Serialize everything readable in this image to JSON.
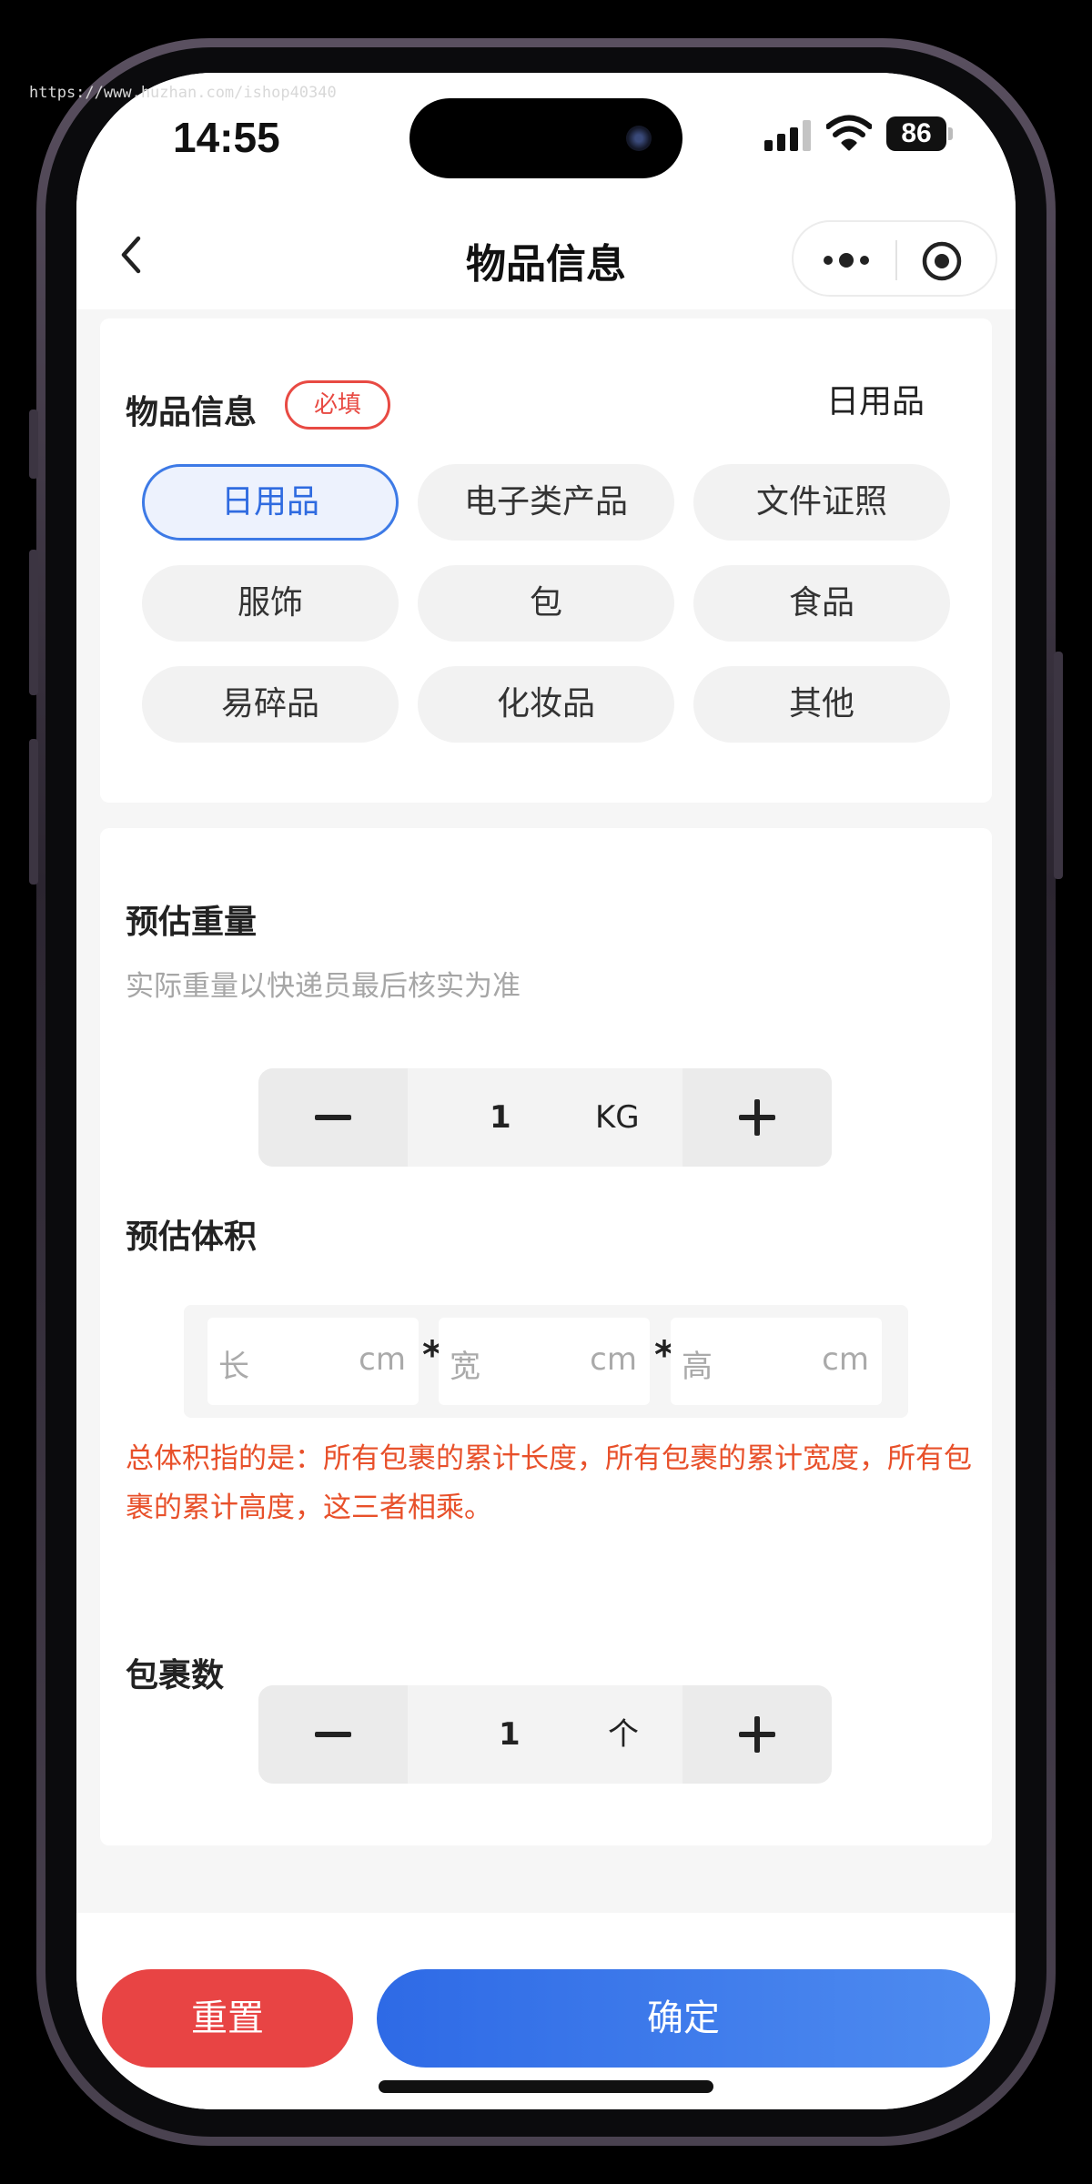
{
  "watermark": "https://www.huzhan.com/ishop40340",
  "status": {
    "time": "14:55",
    "battery": "86"
  },
  "nav": {
    "title": "物品信息"
  },
  "item_section": {
    "title": "物品信息",
    "required_badge": "必填",
    "selected": "日用品",
    "categories": [
      {
        "label": "日用品",
        "selected": true
      },
      {
        "label": "电子类产品",
        "selected": false
      },
      {
        "label": "文件证照",
        "selected": false
      },
      {
        "label": "服饰",
        "selected": false
      },
      {
        "label": "包",
        "selected": false
      },
      {
        "label": "食品",
        "selected": false
      },
      {
        "label": "易碎品",
        "selected": false
      },
      {
        "label": "化妆品",
        "selected": false
      },
      {
        "label": "其他",
        "selected": false
      }
    ]
  },
  "weight": {
    "title": "预估重量",
    "hint": "实际重量以快递员最后核实为准",
    "value": "1",
    "unit": "KG"
  },
  "volume": {
    "title": "预估体积",
    "length_placeholder": "长",
    "width_placeholder": "宽",
    "height_placeholder": "高",
    "unit": "cm",
    "separator": "*",
    "note": "总体积指的是：所有包裹的累计长度，所有包裹的累计宽度，所有包裹的累计高度，这三者相乘。"
  },
  "packages": {
    "title": "包裹数",
    "value": "1",
    "unit": "个"
  },
  "actions": {
    "reset": "重置",
    "confirm": "确定"
  }
}
